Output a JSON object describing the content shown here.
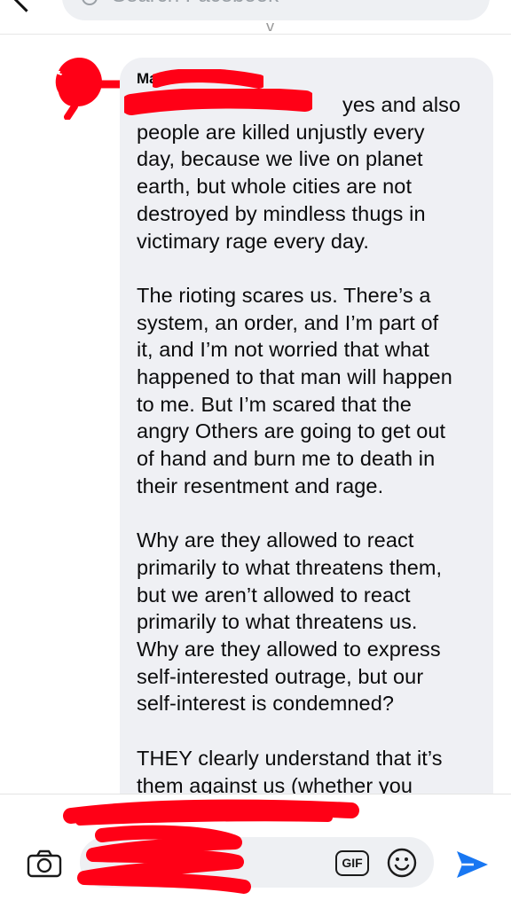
{
  "header": {
    "search_placeholder": "Search Facebook",
    "fragment": "y"
  },
  "message": {
    "sender_name": "Ma",
    "text": "                                   yes and also\npeople are killed unjustly every\nday, because we live on planet\nearth, but whole cities are not\ndestroyed by mindless thugs in\nvictimary rage every day.\n\nThe rioting scares us. There’s a\nsystem, an order, and I’m part of\nit, and I’m not worried that what\nhappened to that man will happen\nto me. But I’m scared that the\nangry Others are going to get out\nof hand and burn me to death in\ntheir resentment and rage.\n\nWhy are they allowed to react\nprimarily to what threatens them,\nbut we aren’t allowed to react\nprimarily to what threatens us.\nWhy are they allowed to express\nself-interested outrage, but our\nself-interest is condemned?\n\nTHEY clearly understand that it’s\nthem against us (whether you"
  },
  "composer": {
    "gif_label": "GIF"
  },
  "colors": {
    "bubble": "#eff0f4",
    "redaction": "#ff0016",
    "send_accent": "#1877f2"
  },
  "icons": [
    "back-chevron-icon",
    "search-icon",
    "camera-icon",
    "emoji-icon",
    "send-icon"
  ]
}
